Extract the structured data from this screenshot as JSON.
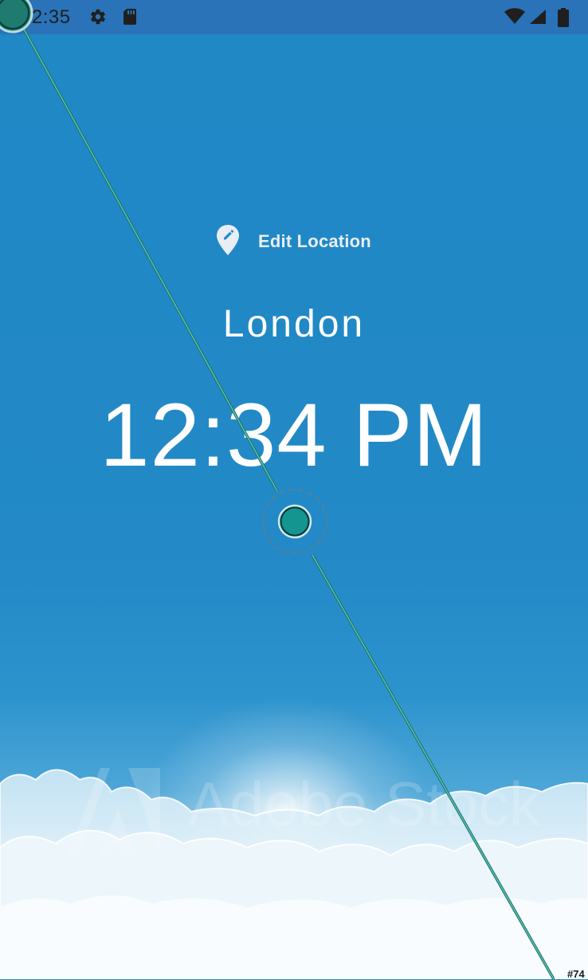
{
  "status_bar": {
    "time": "12:35",
    "icons": [
      "settings-gear-icon",
      "sd-card-icon",
      "wifi-icon",
      "signal-icon",
      "battery-icon"
    ],
    "color": "#2a73b8"
  },
  "location": {
    "edit_label": "Edit Location",
    "icon": "edit-location-pin-icon",
    "city": "London",
    "time": "12:34 PM"
  },
  "background": {
    "watermark": "Adobe Stock",
    "sky_color": "#2389c7"
  },
  "overlay": {
    "line_color": "#3aa89a",
    "corner_id": "#74"
  }
}
